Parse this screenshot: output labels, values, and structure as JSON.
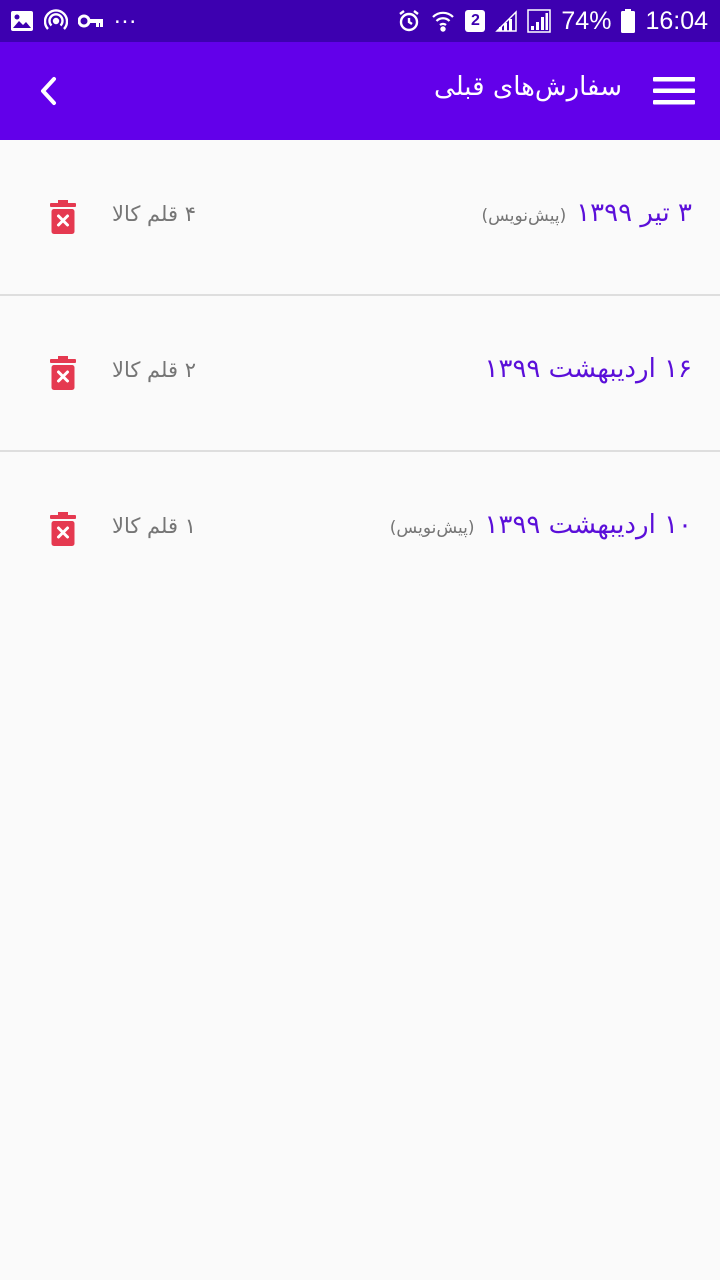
{
  "status_bar": {
    "left_icons": [
      "image-icon",
      "hotspot-icon",
      "vpn-key-icon"
    ],
    "overflow": "...",
    "battery": "74%",
    "time": "16:04",
    "sim_badge": "2"
  },
  "app_bar": {
    "title": "سفارش‌های قبلی",
    "back_icon": "chevron-left-icon",
    "menu_icon": "hamburger-menu-icon",
    "color": "#6200ea"
  },
  "orders": [
    {
      "date": "۳ تیر ۱۳۹۹",
      "draft": "(پیش‌نویس)",
      "count": "۴ قلم کالا"
    },
    {
      "date": "۱۶ اردیبهشت ۱۳۹۹",
      "draft": "",
      "count": "۲ قلم کالا"
    },
    {
      "date": "۱۰ اردیبهشت ۱۳۹۹",
      "draft": "(پیش‌نویس)",
      "count": "۱ قلم کالا"
    }
  ],
  "colors": {
    "status_bar": "#3d00b0",
    "accent": "#5b0fd9",
    "delete": "#e53950",
    "background": "#fafafa"
  }
}
